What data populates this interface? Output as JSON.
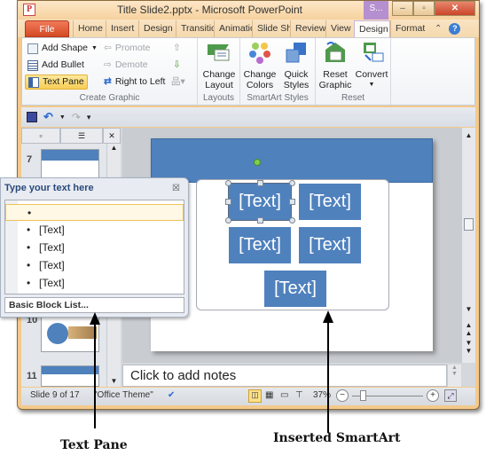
{
  "window": {
    "app_icon": "P",
    "title": "Title Slide2.pptx  -  Microsoft PowerPoint",
    "contextual_tab": "S...",
    "controls": {
      "minimize": "–",
      "maximize": "▫",
      "close": "✕"
    }
  },
  "tabs": [
    {
      "label": "File"
    },
    {
      "label": "Home"
    },
    {
      "label": "Insert"
    },
    {
      "label": "Design"
    },
    {
      "label": "Transitio"
    },
    {
      "label": "Animatio"
    },
    {
      "label": "Slide Sh"
    },
    {
      "label": "Review"
    },
    {
      "label": "View"
    },
    {
      "label": "Design",
      "active": true
    },
    {
      "label": "Format"
    }
  ],
  "tab_icons": {
    "collapse": "⌃",
    "help": "?"
  },
  "ribbon": {
    "create_graphic": {
      "label": "Create Graphic",
      "add_shape": "Add Shape",
      "add_bullet": "Add Bullet",
      "text_pane": "Text Pane",
      "promote": "Promote",
      "demote": "Demote",
      "right_to_left": "Right to Left"
    },
    "layouts": {
      "label": "Layouts",
      "change_layout": "Change Layout"
    },
    "smartart_styles": {
      "label": "SmartArt Styles",
      "change_colors": "Change Colors",
      "quick_styles": "Quick Styles"
    },
    "reset": {
      "label": "Reset",
      "reset_graphic": "Reset Graphic",
      "convert": "Convert"
    }
  },
  "thumbnails": [
    {
      "number": "7"
    },
    {
      "number": "10"
    },
    {
      "number": "11"
    }
  ],
  "text_pane": {
    "title": "Type your text here",
    "close": "☒",
    "items": [
      "",
      "[Text]",
      "[Text]",
      "[Text]",
      "[Text]"
    ],
    "footer": "Basic Block List..."
  },
  "smartart": {
    "boxes": [
      "[Text]",
      "[Text]",
      "[Text]",
      "[Text]",
      "[Text]"
    ]
  },
  "notes": {
    "placeholder": "Click to add notes"
  },
  "status": {
    "slide": "Slide 9 of 17",
    "theme": "\"Office Theme\"",
    "zoom": "37%",
    "zoom_level_percent": 37
  },
  "callouts": {
    "text_pane": "Text Pane",
    "inserted_smartart": "Inserted SmartArt"
  }
}
